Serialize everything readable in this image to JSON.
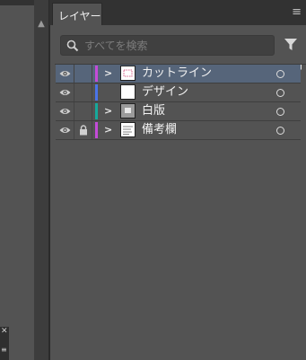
{
  "panel": {
    "tab_label": "レイヤー",
    "search_placeholder": "すべてを検索"
  },
  "layers": [
    {
      "name": "カットライン",
      "color": "#c44bd8",
      "selected": true,
      "locked": false,
      "expandable": true,
      "thumb": "cut"
    },
    {
      "name": "デザイン",
      "color": "#4a74e8",
      "selected": false,
      "locked": false,
      "expandable": false,
      "thumb": "blank"
    },
    {
      "name": "白版",
      "color": "#16a99b",
      "selected": false,
      "locked": false,
      "expandable": true,
      "thumb": "white"
    },
    {
      "name": "備考欄",
      "color": "#c44bd8",
      "selected": false,
      "locked": true,
      "expandable": true,
      "thumb": "notes"
    }
  ],
  "icons": {
    "search": "search-icon",
    "filter": "filter-icon",
    "visibility": "eye-icon",
    "lock": "lock-icon",
    "expand": "chevron-right-icon",
    "target": "target-circle-icon",
    "panel_menu": "hamburger-menu-icon",
    "close": "close-icon"
  }
}
